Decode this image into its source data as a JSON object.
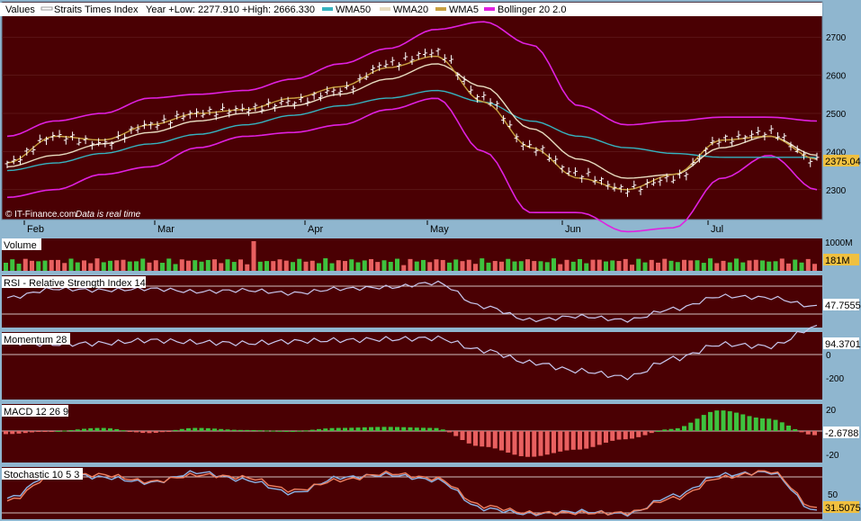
{
  "legend": {
    "values_label": "Values",
    "index_name": "Straits Times Index",
    "range_text": "Year +Low: 2277.910 +High: 2666.330",
    "items": [
      {
        "label": "WMA50",
        "color": "#36b3c0"
      },
      {
        "label": "WMA20",
        "color": "#e8dcc0"
      },
      {
        "label": "WMA5",
        "color": "#c8a040"
      },
      {
        "label": "Bollinger 20 2.0",
        "color": "#e020e0"
      }
    ]
  },
  "price": {
    "y_ticks": [
      "2700",
      "2600",
      "2500",
      "2400",
      "2300"
    ],
    "last_value": "2375.04",
    "copyright": "© IT-Finance.com",
    "realtime_note": "Data is real time"
  },
  "months": [
    "Feb",
    "Mar",
    "Apr",
    "May",
    "Jun",
    "Jul"
  ],
  "panels": {
    "volume": {
      "title": "Volume",
      "axis_label": "1000M",
      "value": "181M"
    },
    "rsi": {
      "title": "RSI - Relative Strength Index 14",
      "value": "47.7555"
    },
    "momentum": {
      "title": "Momentum 28",
      "axis_labels": [
        "0",
        "-200"
      ],
      "value": "94.3701"
    },
    "macd": {
      "title": "MACD 12 26 9",
      "axis_labels": [
        "20",
        "-20"
      ],
      "value": "-2.6788"
    },
    "stochastic": {
      "title": "Stochastic 10 5 3",
      "axis_label": "50",
      "value": "31.5075"
    }
  },
  "colors": {
    "panel_bg": "#4a0003",
    "frame": "#8fb6cf",
    "up": "#3ec23e",
    "down": "#e86060",
    "indicator_line": "#c8c8f0",
    "stoch_k": "#8cb4e8",
    "stoch_d": "#f08060",
    "price_tag": "#f0c040"
  },
  "chart_data": {
    "type": "line",
    "title": "Straits Times Index",
    "x": [
      "Feb",
      "Mar",
      "Apr",
      "May",
      "Jun",
      "Jul"
    ],
    "ylim": [
      2250,
      2750
    ],
    "series": [
      {
        "name": "Straits Times Index",
        "values": [
          2370,
          2440,
          2420,
          2470,
          2500,
          2510,
          2530,
          2560,
          2630,
          2660,
          2540,
          2410,
          2340,
          2300,
          2330,
          2430,
          2450,
          2375
        ]
      },
      {
        "name": "WMA50",
        "values": [
          2350,
          2370,
          2395,
          2420,
          2445,
          2470,
          2495,
          2520,
          2540,
          2560,
          2530,
          2480,
          2440,
          2410,
          2395,
          2385,
          2385,
          2385
        ]
      },
      {
        "name": "WMA20",
        "values": [
          2360,
          2390,
          2420,
          2450,
          2480,
          2500,
          2520,
          2550,
          2590,
          2630,
          2570,
          2460,
          2380,
          2330,
          2340,
          2410,
          2440,
          2390
        ]
      },
      {
        "name": "WMA5",
        "values": [
          2370,
          2440,
          2430,
          2470,
          2500,
          2510,
          2540,
          2570,
          2620,
          2650,
          2530,
          2410,
          2330,
          2300,
          2340,
          2430,
          2440,
          2380
        ]
      },
      {
        "name": "Bollinger 20 2.0",
        "values": [
          2440,
          2480,
          2500,
          2540,
          2550,
          2560,
          2590,
          2630,
          2670,
          2720,
          2740,
          2680,
          2520,
          2470,
          2480,
          2490,
          2490,
          2480
        ]
      }
    ]
  }
}
